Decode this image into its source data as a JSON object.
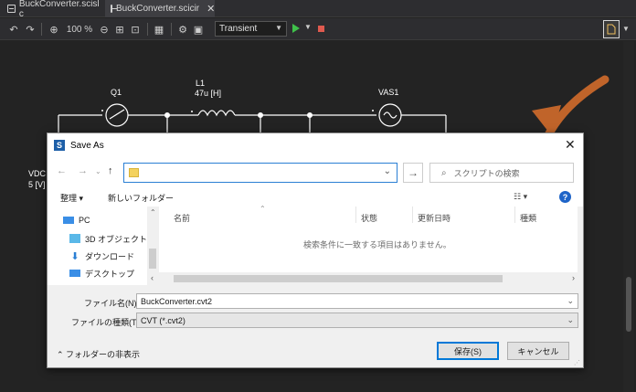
{
  "tabs": [
    {
      "label": "BuckConverter.scisl c"
    },
    {
      "label": "BuckConverter.scicir"
    }
  ],
  "toolbar": {
    "zoom_level": "100 %",
    "sim_mode": "Transient"
  },
  "schematic": {
    "q1": "Q1",
    "l1": "L1",
    "l1_value": "47u [H]",
    "vas1": "VAS1",
    "vdc": "VDC",
    "vdc_value": "5 [V]"
  },
  "dialog": {
    "title": "Save As",
    "search_placeholder": "スクリプトの検索",
    "organize": "整理 ▾",
    "new_folder": "新しいフォルダー",
    "nav_items": [
      {
        "label": "PC"
      },
      {
        "label": "3D オブジェクト"
      },
      {
        "label": "ダウンロード"
      },
      {
        "label": "デスクトップ"
      }
    ],
    "columns": [
      "名前",
      "状態",
      "更新日時",
      "種類"
    ],
    "empty_message": "検索条件に一致する項目はありません。",
    "filename_label": "ファイル名(N):",
    "filename_value": "BuckConverter.cvt2",
    "filetype_label": "ファイルの種類(T):",
    "filetype_value": "CVT (*.cvt2)",
    "hide_folders": "フォルダーの非表示",
    "save_label": "保存(S)",
    "cancel_label": "キャンセル"
  },
  "colors": {
    "accent_arrow": "#c0642a",
    "play": "#3fc04a",
    "stop": "#e05a4f"
  }
}
